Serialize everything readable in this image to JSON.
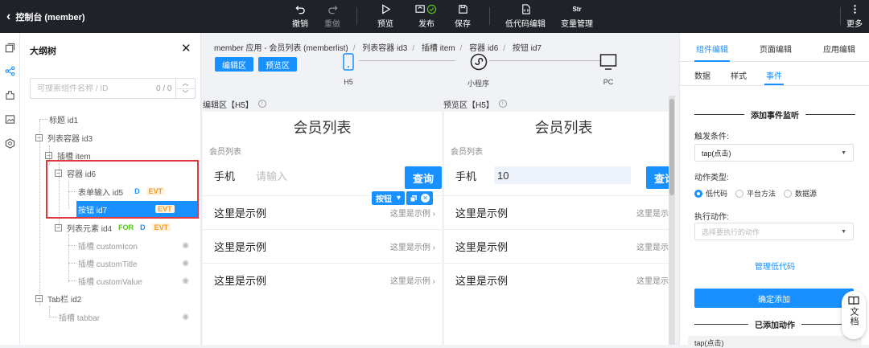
{
  "topbar": {
    "back_label": "控制台 (member)",
    "actions": [
      {
        "label": "撤销",
        "icon": "undo-icon",
        "enabled": true
      },
      {
        "label": "重做",
        "icon": "redo-icon",
        "enabled": false
      },
      {
        "label": "预览",
        "icon": "play-icon",
        "enabled": true
      },
      {
        "label": "发布",
        "icon": "publish-icon",
        "enabled": true
      },
      {
        "label": "保存",
        "icon": "save-icon",
        "enabled": true
      },
      {
        "label": "低代码编辑",
        "icon": "code-file-icon",
        "enabled": true
      },
      {
        "label": "变量管理",
        "icon": "variable-icon",
        "enabled": true
      },
      {
        "label": "更多",
        "icon": "more-icon",
        "enabled": true
      }
    ],
    "variable_icon_text": "Str"
  },
  "tree": {
    "title": "大纲树",
    "search_placeholder": "可搜索组件名称 / ID",
    "search_count": "0 / 0",
    "nodes": [
      {
        "label": "标题 id1"
      },
      {
        "label": "列表容器 id3"
      },
      {
        "label": "插槽 item"
      },
      {
        "label": "容器 id6"
      },
      {
        "label": "表单输入 id5",
        "tags": [
          "D",
          "EVT"
        ]
      },
      {
        "label": "按钮 id7",
        "tags": [
          "EVT"
        ]
      },
      {
        "label": "列表元素 id4",
        "tags": [
          "FOR",
          "D",
          "EVT"
        ]
      },
      {
        "label": "插槽 customIcon"
      },
      {
        "label": "插槽 customTitle"
      },
      {
        "label": "插槽 customValue"
      },
      {
        "label": "Tab栏 id2"
      },
      {
        "label": "插槽 tabbar"
      }
    ],
    "expand_glyph": "−"
  },
  "canvas": {
    "breadcrumb": [
      "member 应用 - 会员列表 (memberlist)",
      "列表容器 id3",
      "插槽 item",
      "容器 id6",
      "按钮 id7"
    ],
    "edit_mode_label": "编辑区",
    "preview_mode_label": "预览区",
    "devices": [
      {
        "label": "H5"
      },
      {
        "label": "小程序"
      },
      {
        "label": "PC"
      }
    ],
    "edit_header": "编辑区【H5】",
    "preview_header": "预览区【H5】",
    "info_glyph": "i",
    "edit_phone": {
      "title": "会员列表",
      "subtitle": "会员列表",
      "field_label": "手机",
      "field_placeholder": "请输入",
      "query_label": "查询",
      "items": [
        {
          "left": "这里是示例",
          "right": "这里是示例"
        },
        {
          "left": "这里是示例",
          "right": "这里是示例"
        },
        {
          "left": "这里是示例",
          "right": "这里是示例"
        }
      ]
    },
    "preview_phone": {
      "title": "会员列表",
      "subtitle": "会员列表",
      "field_label": "手机",
      "field_value": "10",
      "query_label": "查询",
      "items": [
        {
          "left": "这里是示例",
          "right": "这里是示例"
        },
        {
          "left": "这里是示例",
          "right": "这里是示例"
        },
        {
          "left": "这里是示例",
          "right": "这里是示例"
        }
      ]
    },
    "selection_toolbar": {
      "label": "按钮",
      "dropdown_glyph": "▾",
      "close_glyph": "✕"
    }
  },
  "right_panel": {
    "tabs": [
      {
        "label": "组件编辑"
      },
      {
        "label": "页面编辑"
      },
      {
        "label": "应用编辑"
      }
    ],
    "subtabs": [
      {
        "label": "数据"
      },
      {
        "label": "样式"
      },
      {
        "label": "事件"
      }
    ],
    "section_title": "添加事件监听",
    "trigger_label": "触发条件:",
    "trigger_value": "tap(点击)",
    "action_type_label": "动作类型:",
    "action_types": [
      {
        "label": "低代码",
        "selected": true
      },
      {
        "label": "平台方法",
        "selected": false
      },
      {
        "label": "数据源",
        "selected": false
      }
    ],
    "exec_label": "执行动作:",
    "exec_placeholder": "选择要执行的动作",
    "manage_link": "管理低代码",
    "confirm_button": "确定添加",
    "added_section": "已添加动作",
    "added_item": "tap(点击)",
    "caret_glyph": "▼"
  },
  "doc_float": {
    "label": "文档"
  },
  "colors": {
    "accent": "#1890ff",
    "topbar": "#1f2329",
    "highlight": "#e0383e",
    "evt_tag": "#f59a23",
    "for_tag": "#52c41a"
  }
}
